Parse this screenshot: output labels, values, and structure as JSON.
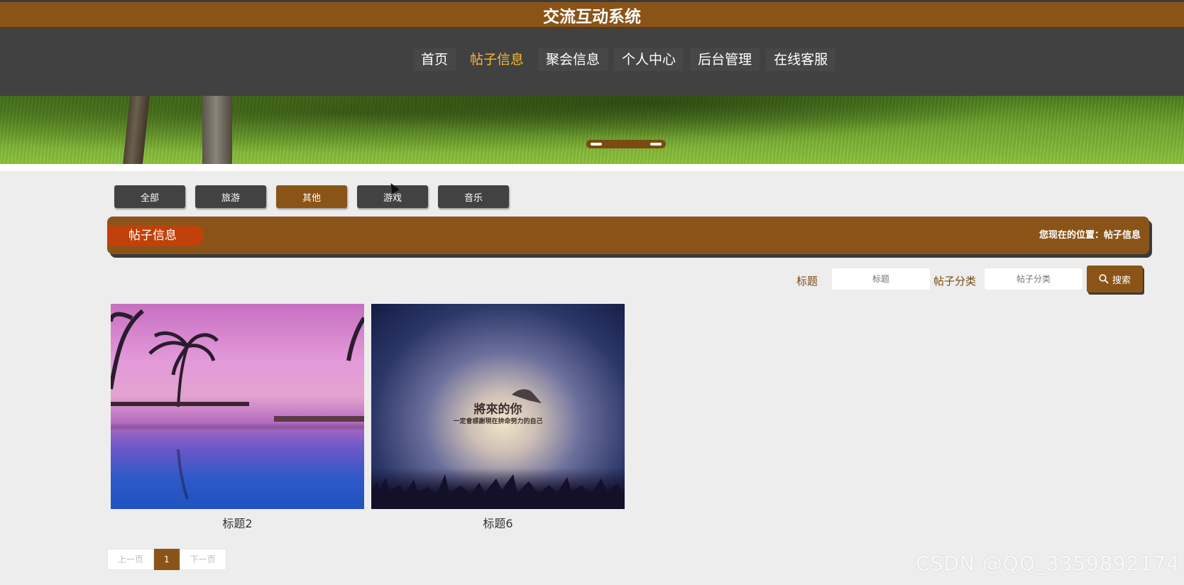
{
  "header": {
    "title": "交流互动系统"
  },
  "nav": {
    "items": [
      {
        "label": "首页"
      },
      {
        "label": "帖子信息"
      },
      {
        "label": "聚会信息"
      },
      {
        "label": "个人中心"
      },
      {
        "label": "后台管理"
      },
      {
        "label": "在线客服"
      }
    ],
    "active_index": 1,
    "active_color": "#f5b833"
  },
  "category_tabs": {
    "items": [
      {
        "label": "全部"
      },
      {
        "label": "旅游"
      },
      {
        "label": "其他"
      },
      {
        "label": "游戏"
      },
      {
        "label": "音乐"
      }
    ],
    "active_index": 2
  },
  "section": {
    "title": "帖子信息",
    "breadcrumb": "您现在的位置：帖子信息"
  },
  "search": {
    "title_label": "标题",
    "title_placeholder": "标题",
    "category_label": "帖子分类",
    "category_placeholder": "帖子分类",
    "button_label": "搜索",
    "button_icon": "search-icon"
  },
  "posts": [
    {
      "caption": "标题2"
    },
    {
      "caption": "标题6",
      "image_text": {
        "headline": "將來的你",
        "line1": "一定會感謝現在拚命努力的自己"
      }
    }
  ],
  "pagination": {
    "prev_label": "上一页",
    "current_page": "1",
    "next_label": "下一页"
  },
  "watermark": "CSDN @QQ_3359892174",
  "colors": {
    "brand": "#8a5418",
    "nav_bg": "#414141",
    "section_title_bg": "#c0410a",
    "page_bg": "#ededed"
  }
}
